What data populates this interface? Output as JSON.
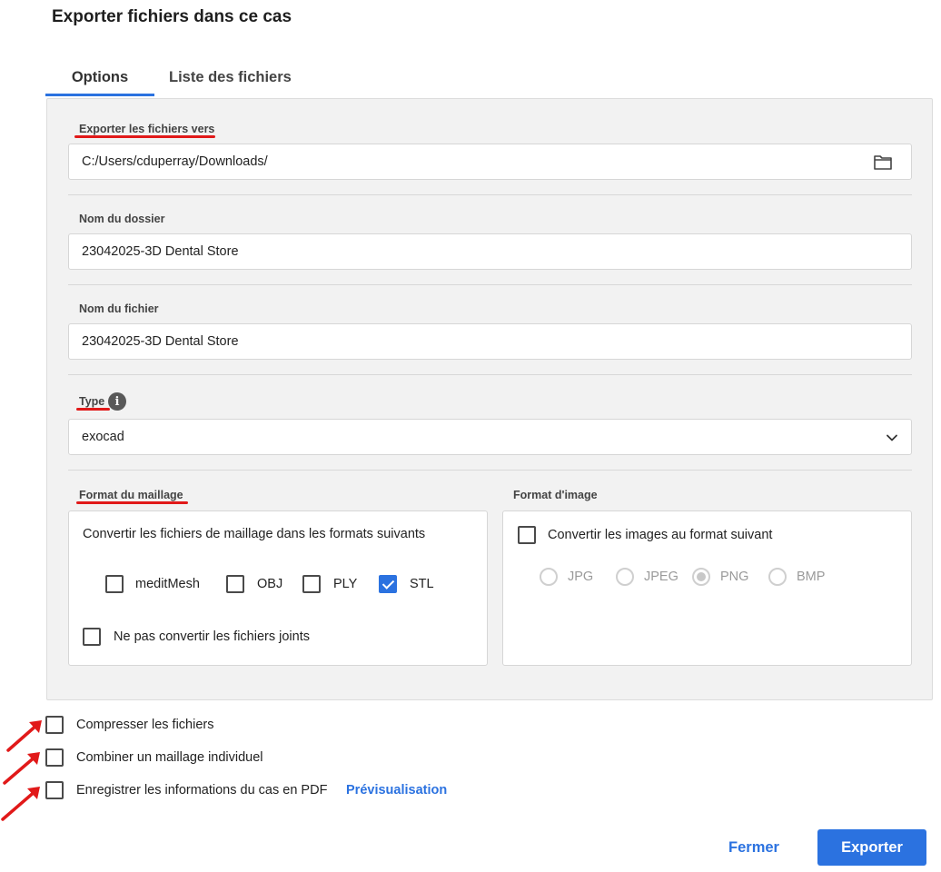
{
  "dialog": {
    "title": "Exporter fichiers dans ce cas"
  },
  "tabs": [
    {
      "label": "Options",
      "active": true
    },
    {
      "label": "Liste des fichiers",
      "active": false
    }
  ],
  "export_path": {
    "label": "Exporter les fichiers vers",
    "value": "C:/Users/cduperray/Downloads/",
    "icon": "folder-icon"
  },
  "folder_name": {
    "label": "Nom du dossier",
    "value": "23042025-3D Dental Store"
  },
  "file_name": {
    "label": "Nom du fichier",
    "value": "23042025-3D Dental Store"
  },
  "type": {
    "label": "Type",
    "value": "exocad",
    "info_icon": "i"
  },
  "mesh_format": {
    "label": "Format du maillage",
    "description": "Convertir les fichiers de maillage dans les formats suivants",
    "options": [
      {
        "label": "meditMesh",
        "checked": false
      },
      {
        "label": "OBJ",
        "checked": false
      },
      {
        "label": "PLY",
        "checked": false
      },
      {
        "label": "STL",
        "checked": true
      }
    ],
    "no_convert_label": "Ne pas convertir les fichiers joints",
    "no_convert_checked": false
  },
  "image_format": {
    "label": "Format d'image",
    "convert_label": "Convertir les images au format suivant",
    "convert_checked": false,
    "options": [
      {
        "label": "JPG",
        "selected": false
      },
      {
        "label": "JPEG",
        "selected": false
      },
      {
        "label": "PNG",
        "selected": true
      },
      {
        "label": "BMP",
        "selected": false
      }
    ]
  },
  "bottom_options": {
    "compress_label": "Compresser les fichiers",
    "combine_label": "Combiner un maillage individuel",
    "pdf_label": "Enregistrer les informations du cas en PDF",
    "preview_link": "Prévisualisation"
  },
  "buttons": {
    "close": "Fermer",
    "export": "Exporter"
  },
  "colors": {
    "accent": "#2b72e0",
    "annotation_red": "#e11919",
    "panel_bg": "#f2f2f2"
  }
}
